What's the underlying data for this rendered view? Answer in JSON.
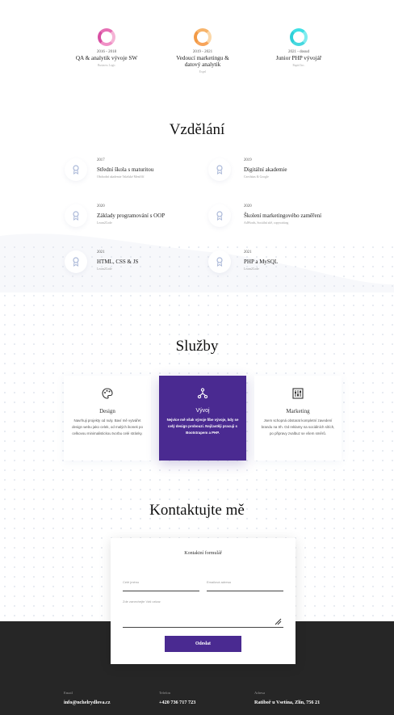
{
  "experience": [
    {
      "years": "2016 - 2018",
      "title": "QA & analytik vývoje SW",
      "company": "Business Logic"
    },
    {
      "years": "2019 - 2021",
      "title": "Vedoucí marketingu & datový analytik",
      "company": "Expel"
    },
    {
      "years": "2021 - dosud",
      "title": "Junior PHP vývojář",
      "company": "Rapid Inc."
    }
  ],
  "education": {
    "title": "Vzdělání",
    "items": [
      {
        "year": "2017",
        "title": "Střední škola s maturitou",
        "school": "Obchodní akademie Valašské Meziříčí"
      },
      {
        "year": "2019",
        "title": "Digitální akademie",
        "school": "Czechitas & Google"
      },
      {
        "year": "2020",
        "title": "Základy programování s OOP",
        "school": "Learn2Code"
      },
      {
        "year": "2020",
        "title": "Školení marketingového zaměření",
        "school": "AdWords, Sociální sítě, copywriting"
      },
      {
        "year": "2021",
        "title": "HTML, CSS & JS",
        "school": "Learn2Code"
      },
      {
        "year": "2021",
        "title": "PHP a MySQL",
        "school": "Learn2Code"
      }
    ]
  },
  "services": {
    "title": "Služby",
    "items": [
      {
        "title": "Design",
        "desc": "Navrhuji projekty od nuly. Baví mě vytvářet design webu jako celek, od malých ikonek po celkovou minimalistickou tvorbu celé stránky."
      },
      {
        "title": "Vývoj",
        "desc": "Nejvíce mě však vývoje fíbe vývoje, kdy se celý design probouzí. Nejčastěji pracuji s Bootstrapem a PHP."
      },
      {
        "title": "Marketing",
        "desc": "Jsem schopná obstarat kompletní zavedení brandu na trh. Od reklamy na sociálních sítích, po připravy zvalbuz se všem směrů."
      }
    ]
  },
  "contact": {
    "title": "Kontaktujte mě",
    "form_title": "Kontaktní formulář",
    "name_placeholder": "Celé jméno",
    "email_placeholder": "Emailová adresa",
    "message_placeholder": "Zde zanechejte Váš vzkaz",
    "submit_label": "Odeslat"
  },
  "footer": {
    "email_label": "Email",
    "email_value": "info@nchelrydlova.cz",
    "phone_label": "Telefon",
    "phone_value": "+420 736 717 723",
    "address_label": "Adresa",
    "address_value": "Ratiboř u Vsetína, Zlín, 756 21"
  }
}
